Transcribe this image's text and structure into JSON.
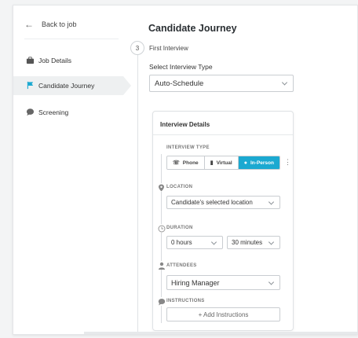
{
  "sidebar": {
    "back_label": "Back to job",
    "items": [
      {
        "label": "Job Details",
        "icon": "briefcase-icon"
      },
      {
        "label": "Candidate Journey",
        "icon": "flag-icon",
        "active": true
      },
      {
        "label": "Screening",
        "icon": "chat-bubble-icon"
      }
    ]
  },
  "main": {
    "title": "Candidate Journey",
    "step_number": "3",
    "step_label": "First Interview",
    "interview_type_label": "Select Interview Type",
    "interview_type_value": "Auto-Schedule"
  },
  "details": {
    "heading": "Interview Details",
    "interview_type_label": "INTERVIEW TYPE",
    "types": [
      {
        "label": "Phone",
        "icon": "phone-icon"
      },
      {
        "label": "Virtual",
        "icon": "video-icon"
      },
      {
        "label": "In-Person",
        "icon": "person-icon",
        "active": true
      }
    ],
    "location_label": "LOCATION",
    "location_value": "Candidate's selected location",
    "duration_label": "DURATION",
    "hours_value": "0 hours",
    "minutes_value": "30 minutes",
    "attendees_label": "ATTENDEES",
    "attendees_value": "Hiring Manager",
    "instructions_label": "INSTRUCTIONS",
    "add_instructions": "+ Add Instructions"
  },
  "colors": {
    "accent": "#1ba9d1",
    "flag": "#1ba9d1"
  }
}
